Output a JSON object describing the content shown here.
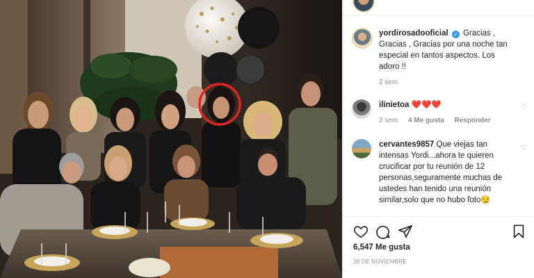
{
  "post": {
    "author": "yordirosadooficial",
    "caption": "Gracias , Gracias , Gracias por una noche tan especial en tantos aspectos. Los adoro !!",
    "caption_time": "2 sem",
    "likes": "6,547 Me gusta",
    "date": "20 DE NOVIEMBRE"
  },
  "comments": [
    {
      "user": "ilinietoa",
      "text": "❤️❤️❤️",
      "time": "2 sem",
      "likes": "4 Me gusta",
      "reply": "Responder"
    },
    {
      "user": "cervantes9857",
      "text": "Que viejas tan intensas Yordi...ahora te quieren crucificar por tu reunión de 12 personas,seguramente muchas de ustedes han tenido una reunión similar,solo que no hubo foto😏"
    }
  ],
  "icons": {
    "verified": "verified-badge-icon",
    "like": "heart-icon",
    "comment": "comment-bubble-icon",
    "share": "paper-plane-icon",
    "save": "bookmark-icon"
  },
  "colors": {
    "verified": "#3897f0",
    "highlight_circle": "#e0241f",
    "meta_text": "#8e8e8e"
  }
}
